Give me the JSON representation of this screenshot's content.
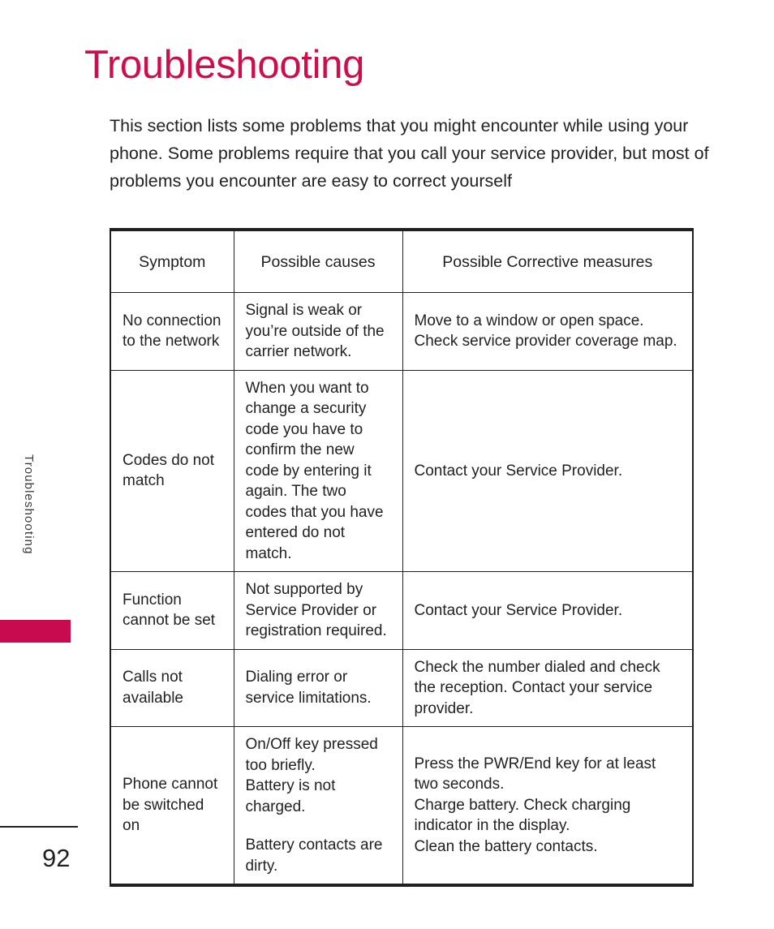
{
  "page": {
    "title": "Troubleshooting",
    "intro": "This section lists some problems that you might encounter while using your phone. Some problems require that you call your service provider, but most of problems you encounter are easy to correct yourself",
    "side_tab_label": "Troubleshooting",
    "page_number": "92",
    "accent_color": "#cd0e4d",
    "tab_color": "#c80b4e",
    "text_color": "#231f20"
  },
  "table": {
    "headers": {
      "symptom": "Symptom",
      "causes": "Possible causes",
      "measures": "Possible Corrective measures"
    },
    "rows": [
      {
        "symptom": "No connection to the network",
        "causes": "Signal is weak or you’re outside of the carrier network.",
        "measures": "Move to a window or open space. Check service provider coverage map."
      },
      {
        "symptom": "Codes do not match",
        "causes": "When you want to change a security code you have to confirm the new code by entering it again. The two codes that you have entered do not match.",
        "measures": "Contact your Service Provider."
      },
      {
        "symptom": "Function cannot be set",
        "causes": "Not supported by Service Provider or registration required.",
        "measures": "Contact your Service Provider."
      },
      {
        "symptom": "Calls not available",
        "causes": "Dialing error or service limitations.",
        "measures": "Check the number dialed and check the reception. Contact your service provider."
      },
      {
        "symptom": "Phone cannot be switched on",
        "causes_part1": "On/Off key pressed too briefly.",
        "causes_part2": "Battery is not charged.",
        "causes_part3": "Battery contacts are dirty.",
        "measures_part1": "Press the PWR/End key for at least two seconds.",
        "measures_part2": "Charge battery. Check charging indicator in the display.",
        "measures_part3": "Clean the battery contacts."
      }
    ]
  }
}
